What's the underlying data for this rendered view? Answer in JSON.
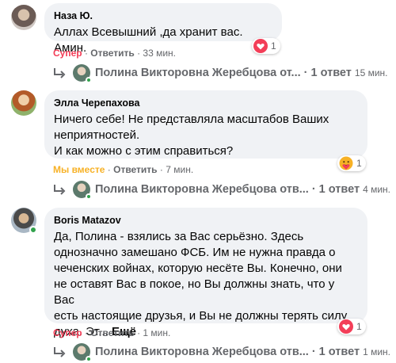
{
  "comments": [
    {
      "author": "Наза Ю.",
      "lines": [
        "Аллах Всевышний ,да хранит вас. Амин."
      ],
      "reaction_label": "Супер",
      "reply_label": "Ответить",
      "time": "33 мин.",
      "reaction_icon": "love-icon",
      "reaction_count": "1",
      "reply_thread": {
        "name": "Полина Викторовна Жеребцова от...",
        "count": "· 1 ответ",
        "time": "15 мин."
      }
    },
    {
      "author": "Элла Черепахова",
      "lines": [
        "Ничего себе! Не представляла масштабов Ваших",
        "неприятностей.",
        "И как можно с этим справиться?"
      ],
      "reaction_label": "Мы вместе",
      "reply_label": "Ответить",
      "time": "7 мин.",
      "reaction_icon": "care-icon",
      "reaction_count": "1",
      "reply_thread": {
        "name": "Полина Викторовна Жеребцова отв...",
        "count": "· 1 ответ",
        "time": "4 мин."
      }
    },
    {
      "author": "Boris Matazov",
      "lines": [
        "Да, Полина - взялись за Вас серьёзно. Здесь",
        "однозначно замешано ФСБ. Им не нужна правда о",
        "чеченских войнах, которую несёте Вы. Конечно, они",
        "не оставят Вас в покое, но Вы должны знать, что у Вас",
        "есть настоящие друзья, и Вы не должны терять силу"
      ],
      "last_line": "духа. Эт...",
      "see_more": "Ещё",
      "reaction_label": "Супер",
      "reply_label": "Ответить",
      "time": "1 мин.",
      "reaction_icon": "love-icon",
      "reaction_count": "1",
      "reply_thread": {
        "name": "Полина Викторовна Жеребцова отв...",
        "count": "· 1 ответ",
        "time": "1 мин."
      }
    }
  ],
  "colors": {
    "bubble": "#f0f2f5",
    "secondary_text": "#65676b",
    "love_red": "#f33e58",
    "care_yellow": "#f7b125",
    "online_green": "#31a24c"
  }
}
